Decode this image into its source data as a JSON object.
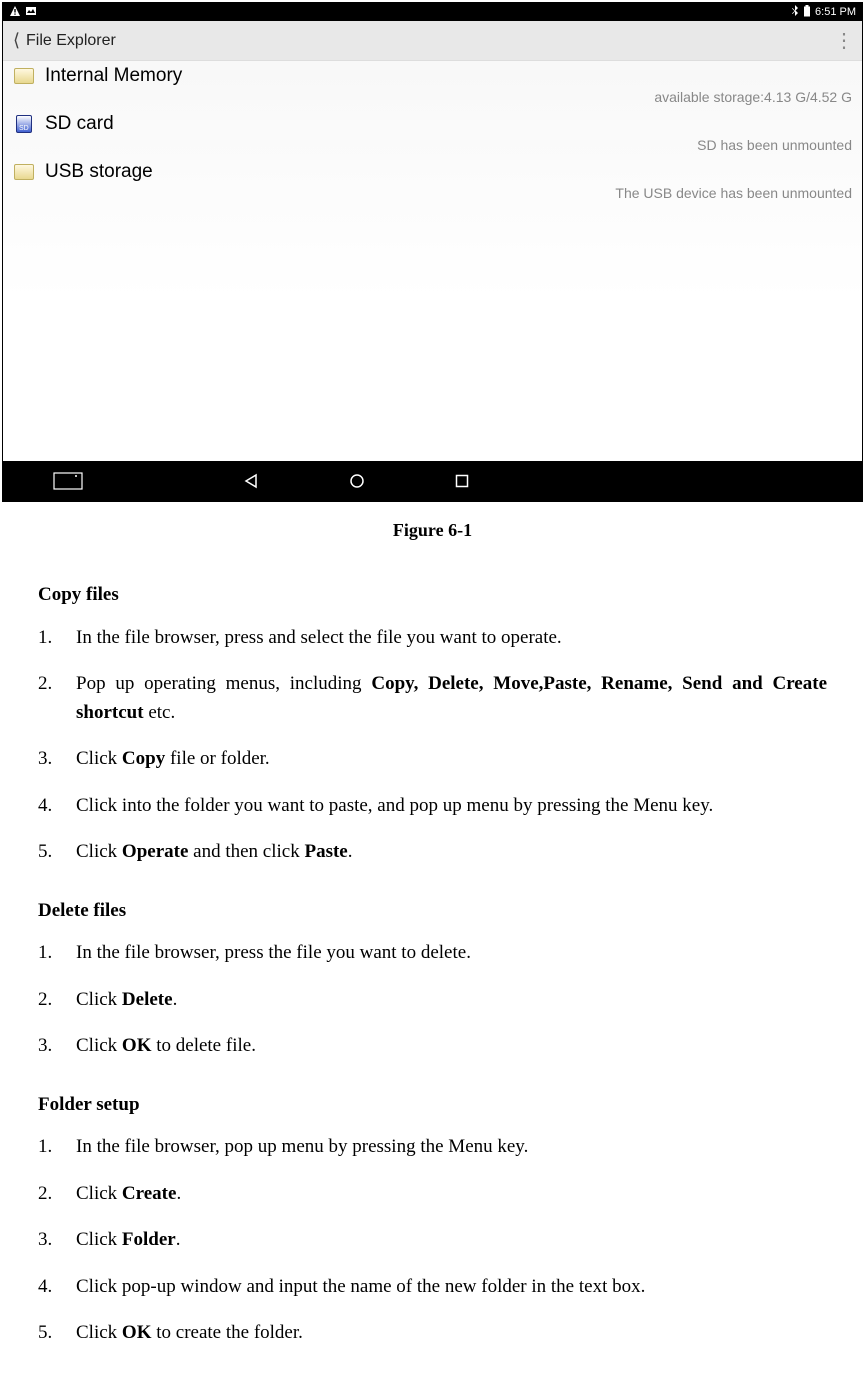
{
  "status_bar": {
    "time": "6:51 PM"
  },
  "app_header": {
    "title": "File Explorer"
  },
  "storage_items": [
    {
      "label": "Internal Memory",
      "status": "available storage:4.13 G/4.52 G",
      "icon": "folder"
    },
    {
      "label": "SD card",
      "status": "SD has been unmounted",
      "icon": "sd"
    },
    {
      "label": "USB storage",
      "status": "The USB device has been unmounted",
      "icon": "folder"
    }
  ],
  "figure_caption": "Figure 6-1",
  "sections": {
    "copy": {
      "title": "Copy files",
      "steps_html": [
        "In the file browser, press and select the file you want to operate.",
        "Pop up operating menus, including <span class=\"bold\">Copy, Delete, Move,Paste, Rename, Send and Create shortcut</span> etc.",
        "Click <span class=\"bold\">Copy</span> file or folder.",
        "Click into the folder you want to paste, and pop up menu by pressing the Menu key.",
        "Click <span class=\"bold\">Operate</span> and then click <span class=\"bold\">Paste</span>."
      ]
    },
    "delete": {
      "title": "Delete files",
      "steps_html": [
        "In the file browser, press the file you want to delete.",
        "Click <span class=\"bold\">Delete</span>.",
        "Click <span class=\"bold\">OK</span> to delete file."
      ]
    },
    "folder": {
      "title": "Folder setup",
      "steps_html": [
        "In the file browser, pop up menu by pressing the Menu key.",
        "Click <span class=\"bold\">Create</span>.",
        "Click <span class=\"bold\">Folder</span>.",
        "Click pop-up window and input the name of the new folder in the text box.",
        "Click <span class=\"bold\">OK</span> to create the folder."
      ]
    }
  }
}
